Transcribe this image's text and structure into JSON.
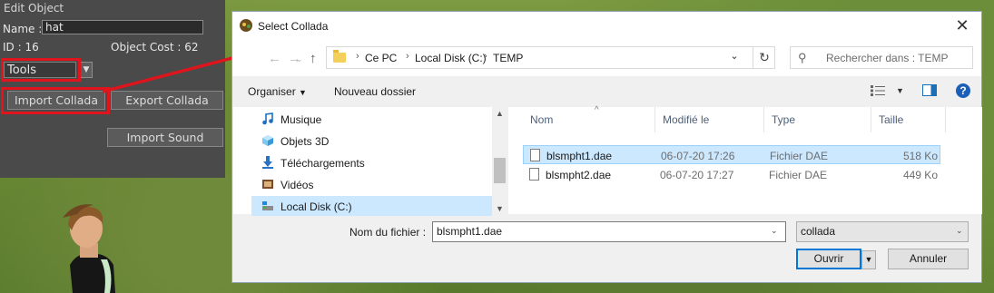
{
  "edit_panel": {
    "title": "Edit Object",
    "name_label": "Name :",
    "name_value": "hat",
    "id_text": "ID : 16",
    "cost_text": "Object Cost : 62",
    "dropdown_value": "Tools",
    "import_collada": "Import Collada",
    "export_collada": "Export Collada",
    "import_sound": "Import Sound"
  },
  "dialog": {
    "title": "Select Collada",
    "breadcrumb": [
      "Ce PC",
      "Local Disk (C:)",
      "TEMP"
    ],
    "search_placeholder": "Rechercher dans : TEMP",
    "organize": "Organiser",
    "new_folder": "Nouveau dossier",
    "nav_items": [
      {
        "label": "Musique",
        "icon": "music-icon"
      },
      {
        "label": "Objets 3D",
        "icon": "cube-3d-icon"
      },
      {
        "label": "Téléchargements",
        "icon": "download-icon"
      },
      {
        "label": "Vidéos",
        "icon": "video-icon"
      },
      {
        "label": "Local Disk (C:)",
        "icon": "drive-icon"
      }
    ],
    "columns": [
      "Nom",
      "Modifié le",
      "Type",
      "Taille"
    ],
    "files": [
      {
        "name": "blsmpht1.dae",
        "modified": "06-07-20 17:26",
        "type": "Fichier DAE",
        "size": "518 Ko",
        "selected": true
      },
      {
        "name": "blsmpht2.dae",
        "modified": "06-07-20 17:27",
        "type": "Fichier DAE",
        "size": "449 Ko",
        "selected": false
      }
    ],
    "filename_label": "Nom du fichier :",
    "filename_value": "blsmpht1.dae",
    "filetype_value": "collada",
    "open_button": "Ouvrir",
    "cancel_button": "Annuler"
  },
  "colors": {
    "highlight": "#e0141c",
    "selection": "#cce8ff",
    "accent": "#0078d7"
  }
}
